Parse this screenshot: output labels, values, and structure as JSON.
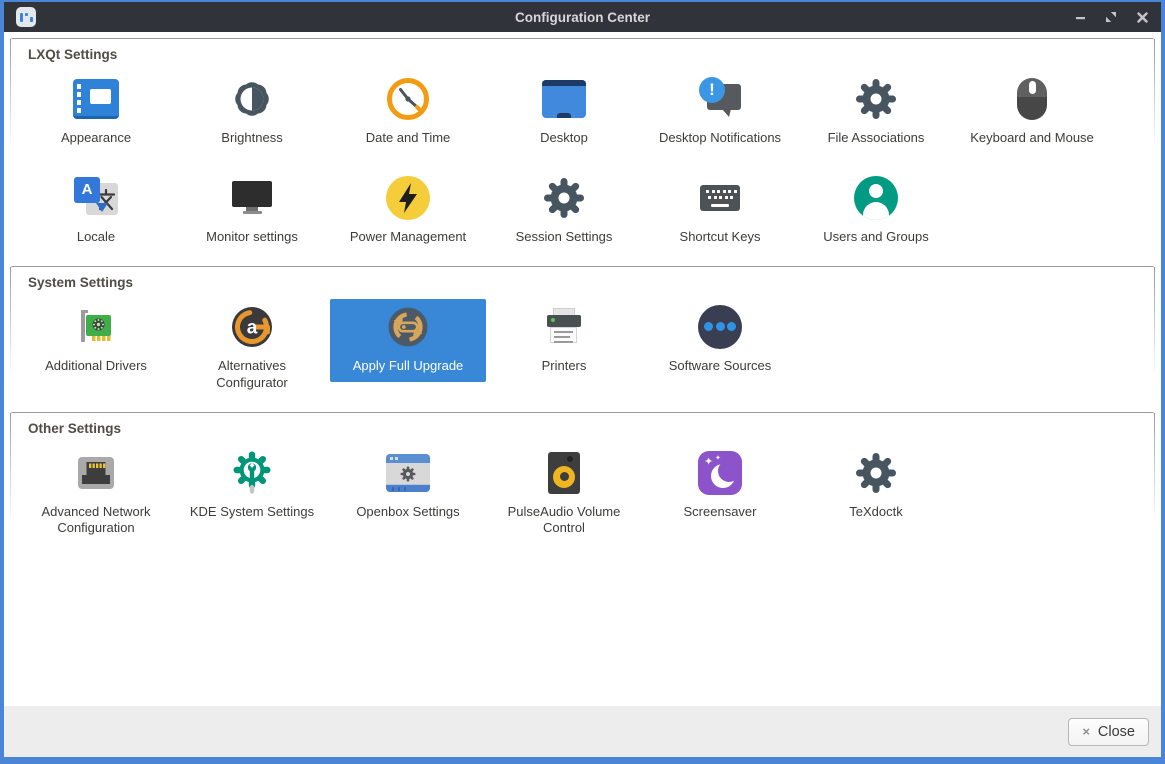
{
  "window": {
    "title": "Configuration Center",
    "app_icon": "lxqt-config-icon",
    "controls": {
      "minimize": "minimize-button",
      "restore": "restore-button",
      "close": "close-button"
    }
  },
  "sections": [
    {
      "title": "LXQt Settings",
      "items": [
        {
          "label": "Appearance",
          "icon": "appearance-icon"
        },
        {
          "label": "Brightness",
          "icon": "brightness-icon"
        },
        {
          "label": "Date and Time",
          "icon": "clock-icon"
        },
        {
          "label": "Desktop",
          "icon": "desktop-icon"
        },
        {
          "label": "Desktop Notifications",
          "icon": "notification-bubble-icon"
        },
        {
          "label": "File Associations",
          "icon": "gear-icon"
        },
        {
          "label": "Keyboard and Mouse",
          "icon": "mouse-icon"
        },
        {
          "label": "Locale",
          "icon": "translate-icon"
        },
        {
          "label": "Monitor settings",
          "icon": "monitor-icon"
        },
        {
          "label": "Power Management",
          "icon": "lightning-bolt-icon"
        },
        {
          "label": "Session Settings",
          "icon": "gear-icon"
        },
        {
          "label": "Shortcut Keys",
          "icon": "keyboard-icon"
        },
        {
          "label": "Users and Groups",
          "icon": "user-circle-icon"
        }
      ]
    },
    {
      "title": "System Settings",
      "items": [
        {
          "label": "Additional Drivers",
          "icon": "pci-card-icon"
        },
        {
          "label": "Alternatives Configurator",
          "icon": "alternatives-icon"
        },
        {
          "label": "Apply Full Upgrade",
          "icon": "upgrade-arrows-icon",
          "selected": true
        },
        {
          "label": "Printers",
          "icon": "printer-icon"
        },
        {
          "label": "Software Sources",
          "icon": "software-sources-icon"
        }
      ]
    },
    {
      "title": "Other Settings",
      "items": [
        {
          "label": "Advanced Network Configuration",
          "icon": "ethernet-port-icon"
        },
        {
          "label": "KDE System Settings",
          "icon": "gear-wrench-icon"
        },
        {
          "label": "Openbox Settings",
          "icon": "window-gear-icon"
        },
        {
          "label": "PulseAudio Volume Control",
          "icon": "speaker-icon"
        },
        {
          "label": "Screensaver",
          "icon": "moon-sparkles-icon"
        },
        {
          "label": "TeXdoctk",
          "icon": "gear-icon"
        }
      ]
    }
  ],
  "footer": {
    "close_label": "Close",
    "close_icon_glyph": "×"
  },
  "glyphs": {
    "minimize": "–",
    "close": "×",
    "notif_exclaim": "!",
    "locale_a": "A",
    "alternatives_a": "a",
    "sparkle_big": "✦",
    "sparkle_small": "✦"
  },
  "colors": {
    "window_border": "#4a86d8",
    "titlebar_bg": "#30333a",
    "selection_blue": "#3987d7",
    "footer_bg": "#ededed",
    "section_title": "#504d46",
    "label_text": "#3d3c39"
  }
}
